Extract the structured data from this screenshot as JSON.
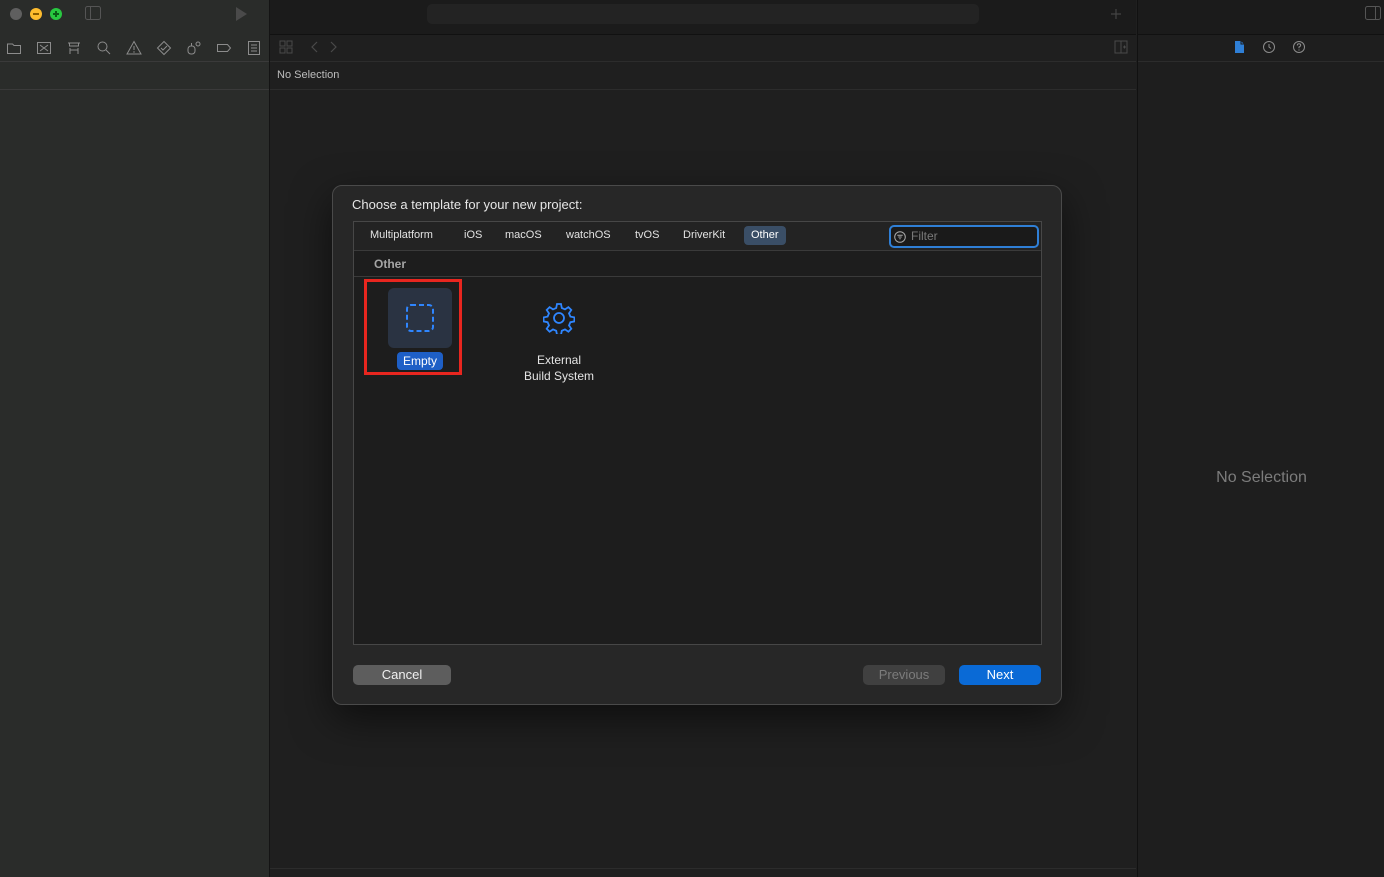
{
  "editor": {
    "jumpbar_text": "No Selection"
  },
  "inspector": {
    "empty_text": "No Selection",
    "tabs": [
      "file-inspector-icon",
      "history-inspector-icon",
      "quick-help-icon"
    ]
  },
  "navigator": {
    "tabs": [
      "folder-icon",
      "source-control-icon",
      "symbol-icon",
      "search-icon",
      "warning-icon",
      "test-icon",
      "debug-icon",
      "breakpoint-icon",
      "report-icon"
    ]
  },
  "dialog": {
    "title": "Choose a template for your new project:",
    "platform_tabs": [
      "Multiplatform",
      "iOS",
      "macOS",
      "watchOS",
      "tvOS",
      "DriverKit",
      "Other"
    ],
    "selected_platform": "Other",
    "filter_placeholder": "Filter",
    "section_label": "Other",
    "templates": [
      {
        "label": "Empty",
        "icon": "dashed-square-icon",
        "selected": true
      },
      {
        "label_line1": "External",
        "label_line2": "Build System",
        "icon": "gear-icon",
        "selected": false
      }
    ],
    "buttons": {
      "cancel": "Cancel",
      "previous": "Previous",
      "next": "Next"
    }
  },
  "colors": {
    "accent": "#0a6ad6",
    "selection_pill": "#1e5fc6",
    "highlight": "#e8261f",
    "template_icon": "#2f86ff"
  }
}
